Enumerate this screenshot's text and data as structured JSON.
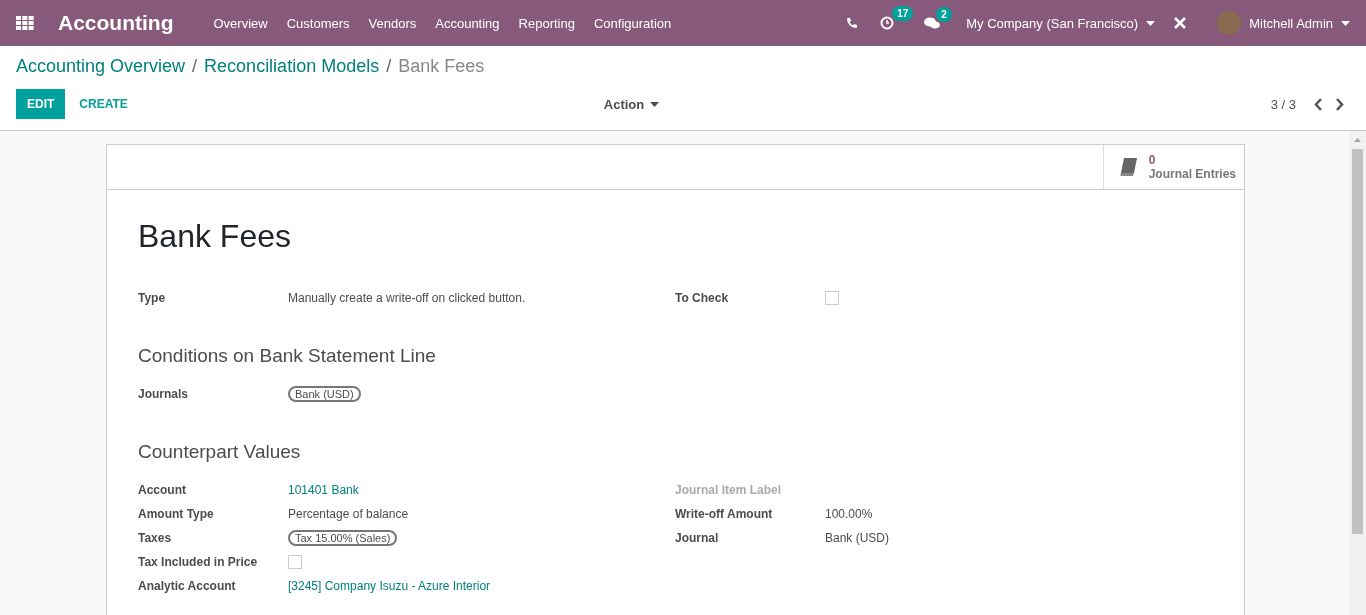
{
  "navbar": {
    "app_title": "Accounting",
    "menu": [
      "Overview",
      "Customers",
      "Vendors",
      "Accounting",
      "Reporting",
      "Configuration"
    ],
    "activity_count": "17",
    "message_count": "2",
    "company": "My Company (San Francisco)",
    "user": "Mitchell Admin"
  },
  "breadcrumbs": [
    {
      "label": "Accounting Overview",
      "current": false
    },
    {
      "label": "Reconciliation Models",
      "current": false
    },
    {
      "label": "Bank Fees",
      "current": true
    }
  ],
  "separator": "/",
  "buttons": {
    "edit": "EDIT",
    "create": "CREATE",
    "action": "Action"
  },
  "pager": "3 / 3",
  "smart_button": {
    "count": "0",
    "label": "Journal Entries"
  },
  "record_title": "Bank Fees",
  "top_fields": {
    "left": [
      {
        "label": "Type",
        "kind": "text",
        "value": "Manually create a write-off on clicked button.",
        "muted": false
      }
    ],
    "right": [
      {
        "label": "To Check",
        "kind": "checkbox",
        "checked": false,
        "muted": false
      }
    ]
  },
  "sections": [
    {
      "title": "Conditions on Bank Statement Line",
      "left": [
        {
          "label": "Journals",
          "kind": "tag",
          "value": "Bank (USD)",
          "muted": false
        }
      ]
    },
    {
      "title": "Counterpart Values",
      "left": [
        {
          "label": "Account",
          "kind": "link",
          "value": "101401 Bank",
          "muted": false
        },
        {
          "label": "Amount Type",
          "kind": "text",
          "value": "Percentage of balance",
          "muted": false
        },
        {
          "label": "Taxes",
          "kind": "tag",
          "value": "Tax 15.00% (Sales)",
          "muted": false
        },
        {
          "label": "Tax Included in Price",
          "kind": "checkbox",
          "checked": false,
          "muted": false
        },
        {
          "label": "Analytic Account",
          "kind": "link",
          "value": "[3245] Company Isuzu - Azure Interior",
          "muted": false
        }
      ],
      "right": [
        {
          "label": "Journal Item Label",
          "kind": "text",
          "muted": true
        },
        {
          "label": "Write-off Amount",
          "kind": "text",
          "value": "100.00%",
          "muted": false
        },
        {
          "label": "Journal",
          "kind": "text",
          "value": "Bank (USD)",
          "muted": false
        }
      ]
    }
  ]
}
